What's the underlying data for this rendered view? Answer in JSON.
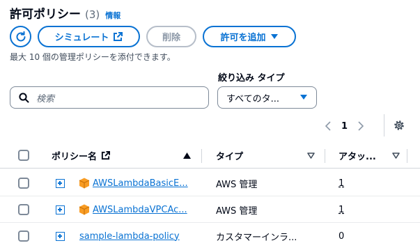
{
  "header": {
    "title": "許可ポリシー",
    "count": "(3)",
    "info": "情報"
  },
  "actions": {
    "simulate": "シミュレート",
    "delete": "削除",
    "add": "許可を追加"
  },
  "description": "最大 10 個の管理ポリシーを添付できます。",
  "filter": {
    "label": "絞り込み タイプ",
    "search_placeholder": "検索",
    "type_value": "すべてのタ..."
  },
  "pagination": {
    "page": "1"
  },
  "table": {
    "columns": {
      "name": "ポリシー名",
      "type": "タイプ",
      "attached": "アタッ..."
    },
    "rows": [
      {
        "name": "AWSLambdaBasicE...",
        "type": "AWS 管理",
        "attached": "1",
        "aws_managed": true
      },
      {
        "name": "AWSLambdaVPCAc...",
        "type": "AWS 管理",
        "attached": "1",
        "aws_managed": true
      },
      {
        "name": "sample-lambda-policy",
        "type": "カスタマーインラ...",
        "attached": "0",
        "aws_managed": false
      }
    ]
  },
  "colors": {
    "accent": "#0972d3",
    "aws_icon": "#f89c24",
    "disabled": "#8d99a8"
  }
}
